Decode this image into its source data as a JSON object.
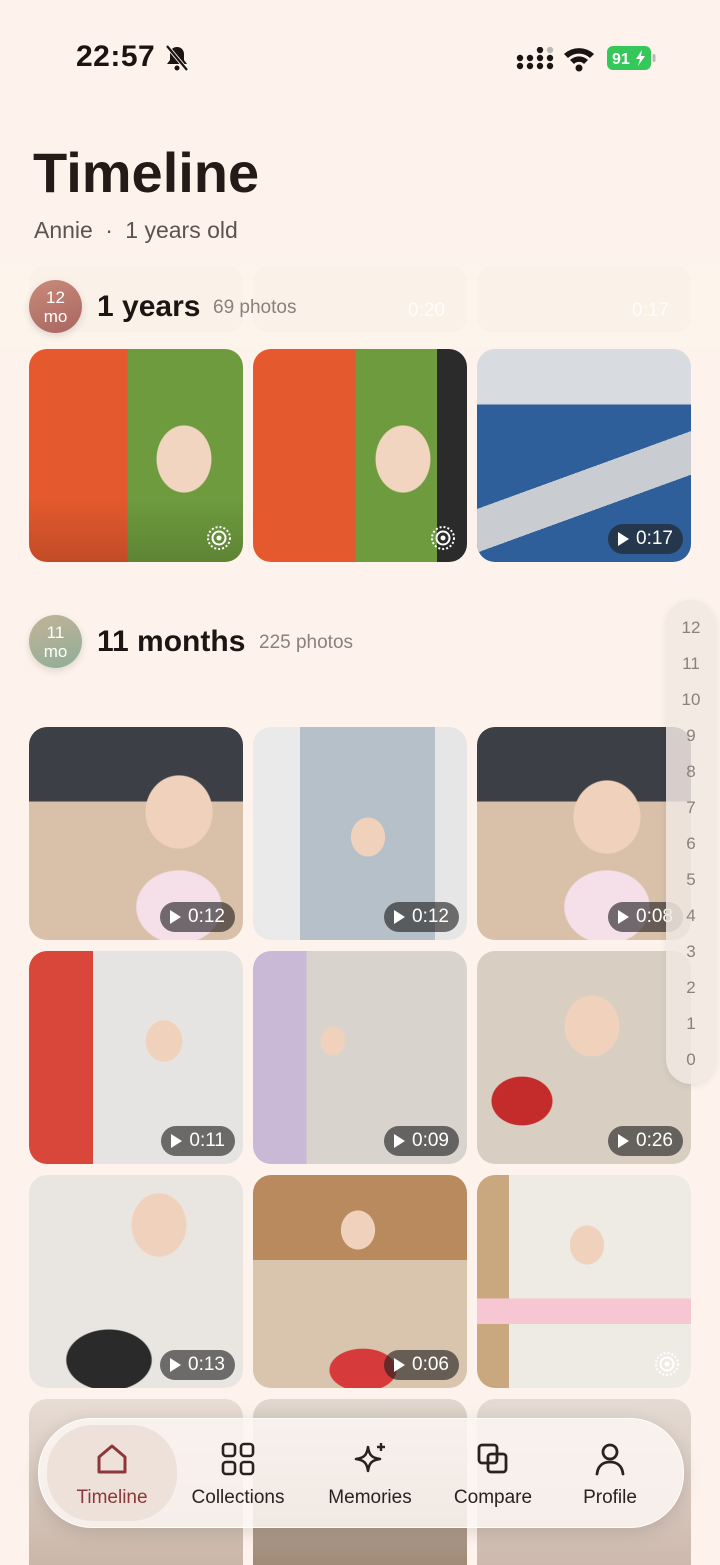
{
  "status": {
    "time": "22:57",
    "battery": "91"
  },
  "header": {
    "title": "Timeline",
    "subtitle_name": "Annie",
    "subtitle_sep": "·",
    "subtitle_age": "1 years old"
  },
  "sections": [
    {
      "badge_top": "12",
      "badge_bottom": "mo",
      "title": "1 years",
      "count": "69 photos",
      "ghost_durations": [
        "0:20",
        "0:17"
      ],
      "photos": [
        {
          "type": "live"
        },
        {
          "type": "live"
        },
        {
          "type": "video",
          "duration": "0:17"
        }
      ]
    },
    {
      "badge_top": "11",
      "badge_bottom": "mo",
      "title": "11 months",
      "count": "225 photos",
      "photos": [
        {
          "type": "video",
          "duration": "0:12"
        },
        {
          "type": "video",
          "duration": "0:12"
        },
        {
          "type": "video",
          "duration": "0:08"
        },
        {
          "type": "video",
          "duration": "0:11"
        },
        {
          "type": "video",
          "duration": "0:09"
        },
        {
          "type": "video",
          "duration": "0:26"
        },
        {
          "type": "video",
          "duration": "0:13"
        },
        {
          "type": "video",
          "duration": "0:06"
        },
        {
          "type": "live"
        }
      ]
    }
  ],
  "index_rail": [
    "12",
    "11",
    "10",
    "9",
    "8",
    "7",
    "6",
    "5",
    "4",
    "3",
    "2",
    "1",
    "0"
  ],
  "tabs": [
    {
      "label": "Timeline",
      "icon": "home-icon",
      "active": true
    },
    {
      "label": "Collections",
      "icon": "grid-icon",
      "active": false
    },
    {
      "label": "Memories",
      "icon": "sparkle-icon",
      "active": false
    },
    {
      "label": "Compare",
      "icon": "compare-icon",
      "active": false
    },
    {
      "label": "Profile",
      "icon": "person-icon",
      "active": false
    }
  ],
  "colors": {
    "accent": "#8d3838",
    "background": "#fdf3ec"
  }
}
